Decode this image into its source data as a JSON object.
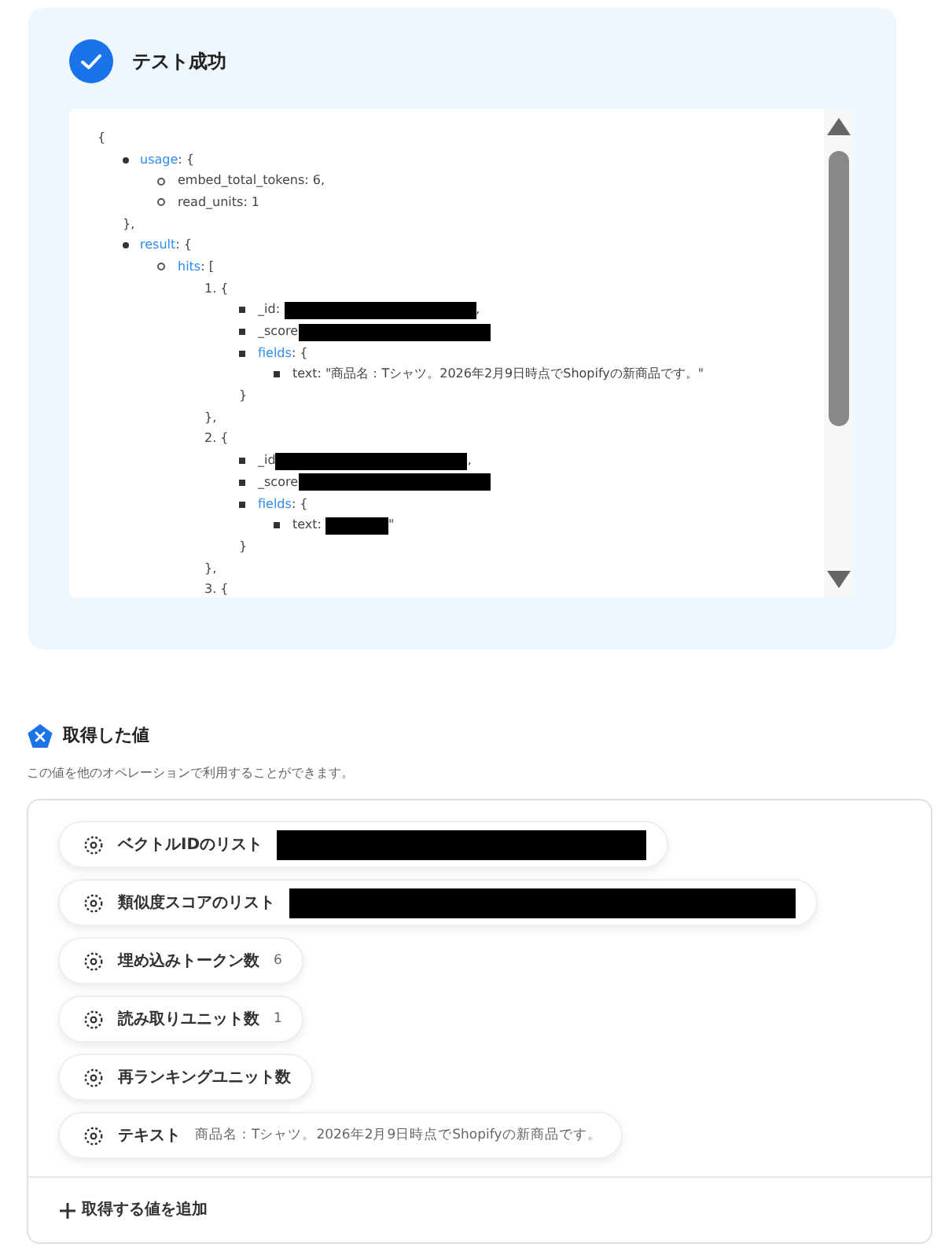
{
  "test_result": {
    "title": "テスト成功",
    "success": true,
    "viewer": {
      "open": "{",
      "kind": "disc",
      "items": [
        {
          "key": "usage",
          "link": true,
          "after": ": {",
          "kind": "circle",
          "children": [
            {
              "key": "embed_total_tokens",
              "after": ": 6,"
            },
            {
              "key": "read_units",
              "after": ": 1"
            }
          ],
          "close": "},"
        },
        {
          "key": "result",
          "link": true,
          "after": ": {",
          "kind": "circle",
          "children": [
            {
              "key": "hits",
              "link": true,
              "after": ": [",
              "kind": "number",
              "children": [
                {
                  "key": "1.",
                  "after": " {",
                  "kind": "square",
                  "children": [
                    {
                      "key": "_id",
                      "after": ": ",
                      "redacted": true,
                      "tail": ","
                    },
                    {
                      "key": "_score",
                      "redacted": true
                    },
                    {
                      "key": "fields",
                      "link": true,
                      "after": ": {",
                      "kind": "square",
                      "children": [
                        {
                          "key": "text",
                          "after": ": \"商品名：Tシャツ。2026年2月9日時点でShopifyの新商品です。\""
                        }
                      ],
                      "close": "}"
                    }
                  ],
                  "close": "},"
                },
                {
                  "key": "2.",
                  "after": " {",
                  "kind": "square",
                  "children": [
                    {
                      "key": "_id",
                      "redacted": true,
                      "tail": ","
                    },
                    {
                      "key": "_score",
                      "redacted": true
                    },
                    {
                      "key": "fields",
                      "link": true,
                      "after": ": {",
                      "kind": "square",
                      "children": [
                        {
                          "key": "text",
                          "after": ": ",
                          "redacted": true,
                          "tail": "\""
                        }
                      ],
                      "close": "}"
                    }
                  ],
                  "close": "},"
                },
                {
                  "key": "3.",
                  "after": " {"
                }
              ]
            }
          ]
        }
      ]
    }
  },
  "values": {
    "title": "取得した値",
    "subtitle": "この値を他のオペレーションで利用することができます。",
    "chips": [
      {
        "label": "ベクトルIDのリスト",
        "redacted": true
      },
      {
        "label": "類似度スコアのリスト",
        "redacted": true
      },
      {
        "label": "埋め込みトークン数",
        "value": "6"
      },
      {
        "label": "読み取りユニット数",
        "value": "1"
      },
      {
        "label": "再ランキングユニット数"
      },
      {
        "label": "テキスト",
        "value": "商品名：Tシャツ。2026年2月9日時点でShopifyの新商品です。"
      }
    ],
    "add_button": "取得する値を追加"
  }
}
